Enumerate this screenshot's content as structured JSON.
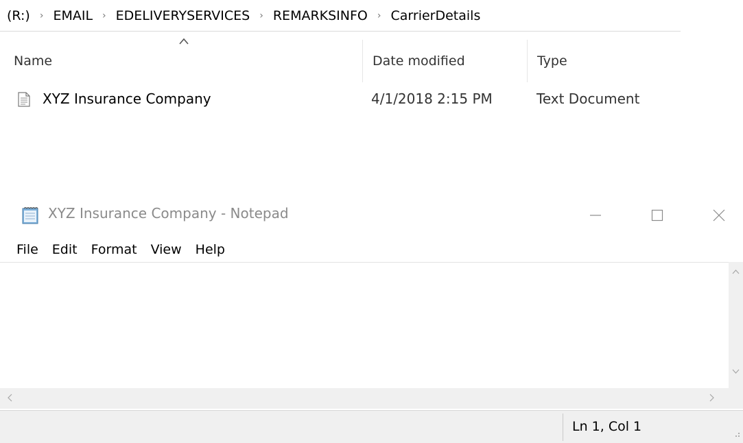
{
  "explorer": {
    "breadcrumb": [
      "(R:)",
      "EMAIL",
      "EDELIVERYSERVICES",
      "REMARKSINFO",
      "CarrierDetails"
    ],
    "columns": {
      "name": "Name",
      "date": "Date modified",
      "type": "Type"
    },
    "files": [
      {
        "name": "XYZ Insurance Company",
        "date": "4/1/2018 2:15 PM",
        "type": "Text Document",
        "icon": "text-document-icon"
      }
    ]
  },
  "notepad": {
    "title": "XYZ Insurance Company - Notepad",
    "icon": "notepad-icon",
    "menu": [
      "File",
      "Edit",
      "Format",
      "View",
      "Help"
    ],
    "content": "",
    "status": "Ln 1, Col 1"
  }
}
